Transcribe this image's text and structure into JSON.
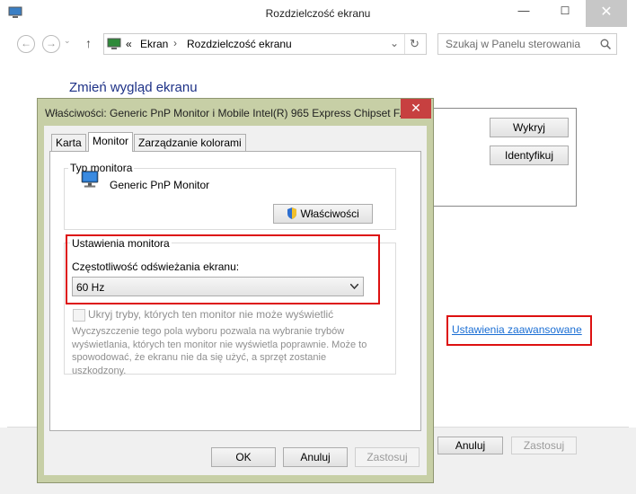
{
  "window": {
    "title": "Rozdzielczość ekranu",
    "minimize": "—",
    "maximize": "☐",
    "close": "✕"
  },
  "nav": {
    "back": "←",
    "forward": "→",
    "up": "↑",
    "chevrons": "«",
    "breadcrumb": [
      "Ekran",
      "Rozdzielczość ekranu"
    ],
    "separator": "›",
    "dropdown": "⌄",
    "refresh": "↻",
    "search_placeholder": "Szukaj w Panelu sterowania",
    "search_icon": "⚲"
  },
  "main": {
    "heading": "Zmień wygląd ekranu",
    "detect_label": "Wykryj",
    "identify_label": "Identyfikuj",
    "advanced_link": "Ustawienia zaawansowane",
    "ok_label": "Anuluj",
    "apply_label": "Zastosuj"
  },
  "dialog": {
    "title": "Właściwości: Generic PnP Monitor i Mobile Intel(R) 965 Express Chipset F...",
    "close": "✕",
    "tabs": [
      "Karta",
      "Monitor",
      "Zarządzanie kolorami"
    ],
    "active_tab": "Monitor",
    "monitor_type_group": "Typ monitora",
    "monitor_name": "Generic PnP Monitor",
    "properties_button": "Właściwości",
    "monitor_settings_group": "Ustawienia monitora",
    "refresh_label": "Częstotliwość odświeżania ekranu:",
    "refresh_value": "60 Hz",
    "hide_modes_label": "Ukryj tryby, których ten monitor nie może wyświetlić",
    "hide_modes_checked": false,
    "description": "Wyczyszczenie tego pola wyboru pozwala na wybranie trybów wyświetlania, których ten monitor nie wyświetla poprawnie. Może to spowodować, że ekranu nie da się użyć, a sprzęt zostanie uszkodzony.",
    "ok": "OK",
    "cancel": "Anuluj",
    "apply": "Zastosuj"
  },
  "colors": {
    "heading": "#1e3287",
    "link": "#1a6ed4",
    "highlight": "#dd1111",
    "dialog_frame": "#c7cfa6"
  }
}
